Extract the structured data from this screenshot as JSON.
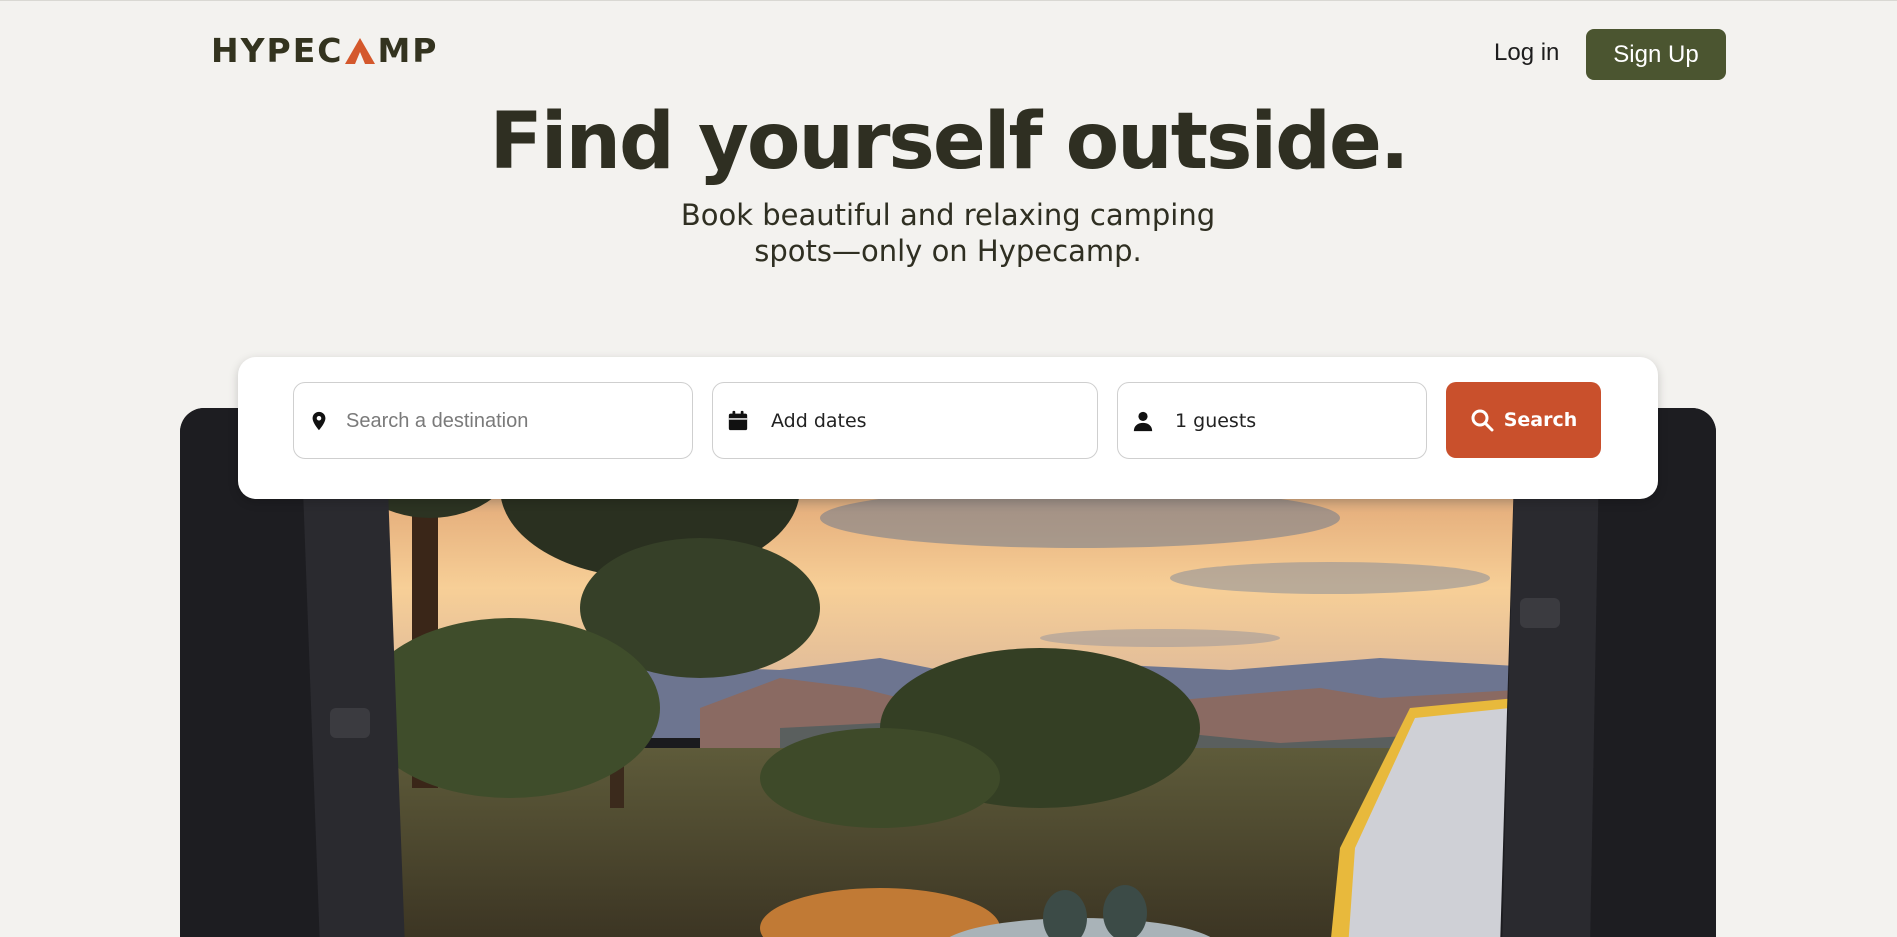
{
  "brand": {
    "logo_text_left": "HYPEC",
    "logo_text_right": "MP",
    "accent": "#d4582c"
  },
  "header": {
    "login_label": "Log in",
    "signup_label": "Sign Up"
  },
  "hero": {
    "headline": "Find yourself outside.",
    "subline": "Book beautiful and relaxing camping spots—only on Hypecamp."
  },
  "search": {
    "destination_placeholder": "Search a destination",
    "dates_label": "Add dates",
    "guests_label": "1 guests",
    "button_label": "Search"
  },
  "colors": {
    "background": "#f3f2ef",
    "primary": "#4b5530",
    "search_button": "#c9502c"
  },
  "icons": [
    "map-pin-icon",
    "calendar-icon",
    "person-icon",
    "search-icon"
  ]
}
